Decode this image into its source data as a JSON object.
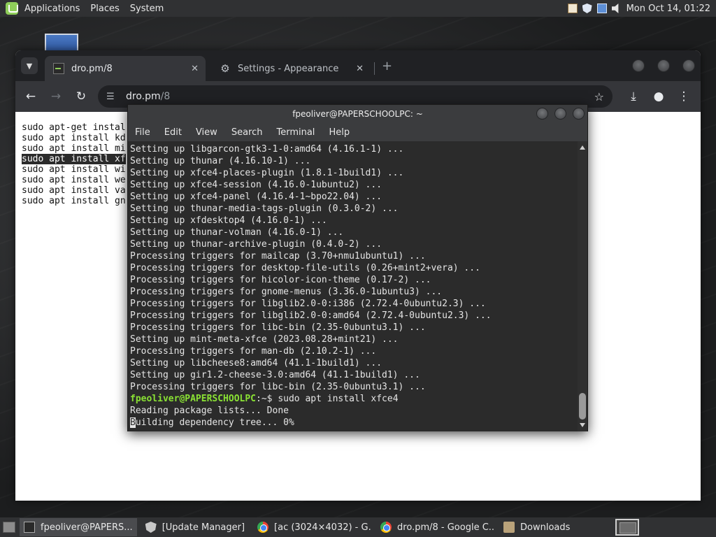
{
  "top_panel": {
    "menu": [
      "Applications",
      "Places",
      "System"
    ],
    "clock": "Mon Oct 14, 01:22"
  },
  "chrome": {
    "tabs": [
      {
        "title": "dro.pm/8",
        "icon": "terminal-favicon-icon",
        "active": true
      },
      {
        "title": "Settings - Appearance",
        "icon": "gear-icon",
        "active": false
      }
    ],
    "new_tab_label": "+",
    "url_host": "dro.pm",
    "url_path": "/8",
    "page_lines": [
      "sudo apt-get instal",
      "sudo apt install kd",
      "sudo apt install mi",
      "sudo apt install xf",
      "sudo apt install wi",
      "sudo apt install we",
      "sudo apt install va",
      "sudo apt install gn"
    ],
    "selected_line_index": 3
  },
  "terminal": {
    "title": "fpeoliver@PAPERSCHOOLPC: ~",
    "menu": [
      "File",
      "Edit",
      "View",
      "Search",
      "Terminal",
      "Help"
    ],
    "lines": [
      "Setting up libgarcon-gtk3-1-0:amd64 (4.16.1-1) ...",
      "Setting up thunar (4.16.10-1) ...",
      "Setting up xfce4-places-plugin (1.8.1-1build1) ...",
      "Setting up xfce4-session (4.16.0-1ubuntu2) ...",
      "Setting up xfce4-panel (4.16.4-1~bpo22.04) ...",
      "Setting up thunar-media-tags-plugin (0.3.0-2) ...",
      "Setting up xfdesktop4 (4.16.0-1) ...",
      "Setting up thunar-volman (4.16.0-1) ...",
      "Setting up thunar-archive-plugin (0.4.0-2) ...",
      "Processing triggers for mailcap (3.70+nmu1ubuntu1) ...",
      "Processing triggers for desktop-file-utils (0.26+mint2+vera) ...",
      "Processing triggers for hicolor-icon-theme (0.17-2) ...",
      "Processing triggers for gnome-menus (3.36.0-1ubuntu3) ...",
      "Processing triggers for libglib2.0-0:i386 (2.72.4-0ubuntu2.3) ...",
      "Processing triggers for libglib2.0-0:amd64 (2.72.4-0ubuntu2.3) ...",
      "Processing triggers for libc-bin (2.35-0ubuntu3.1) ...",
      "Setting up mint-meta-xfce (2023.08.28+mint21) ...",
      "Processing triggers for man-db (2.10.2-1) ...",
      "Setting up libcheese8:amd64 (41.1-1build1) ...",
      "Setting up gir1.2-cheese-3.0:amd64 (41.1-1build1) ...",
      "Processing triggers for libc-bin (2.35-0ubuntu3.1) ..."
    ],
    "prompt_user": "fpeoliver@PAPERSCHOOLPC",
    "prompt_path": ":~$ ",
    "prompt_command": "sudo apt install xfce4",
    "after_lines": [
      "Reading package lists... Done"
    ],
    "last_line_cursor_char": "B",
    "last_line_rest": "uilding dependency tree... 0%"
  },
  "taskbar": {
    "tasks": [
      {
        "label": "fpeoliver@PAPERS...",
        "icon": "terminal-icon",
        "active": true
      },
      {
        "label": "[Update Manager]",
        "icon": "shield-icon",
        "active": false
      },
      {
        "label": "[ac (3024×4032) - G...",
        "icon": "chrome-icon",
        "active": false
      },
      {
        "label": "dro.pm/8 - Google C...",
        "icon": "chrome-icon",
        "active": false
      },
      {
        "label": "Downloads",
        "icon": "folder-icon",
        "active": false
      }
    ]
  }
}
